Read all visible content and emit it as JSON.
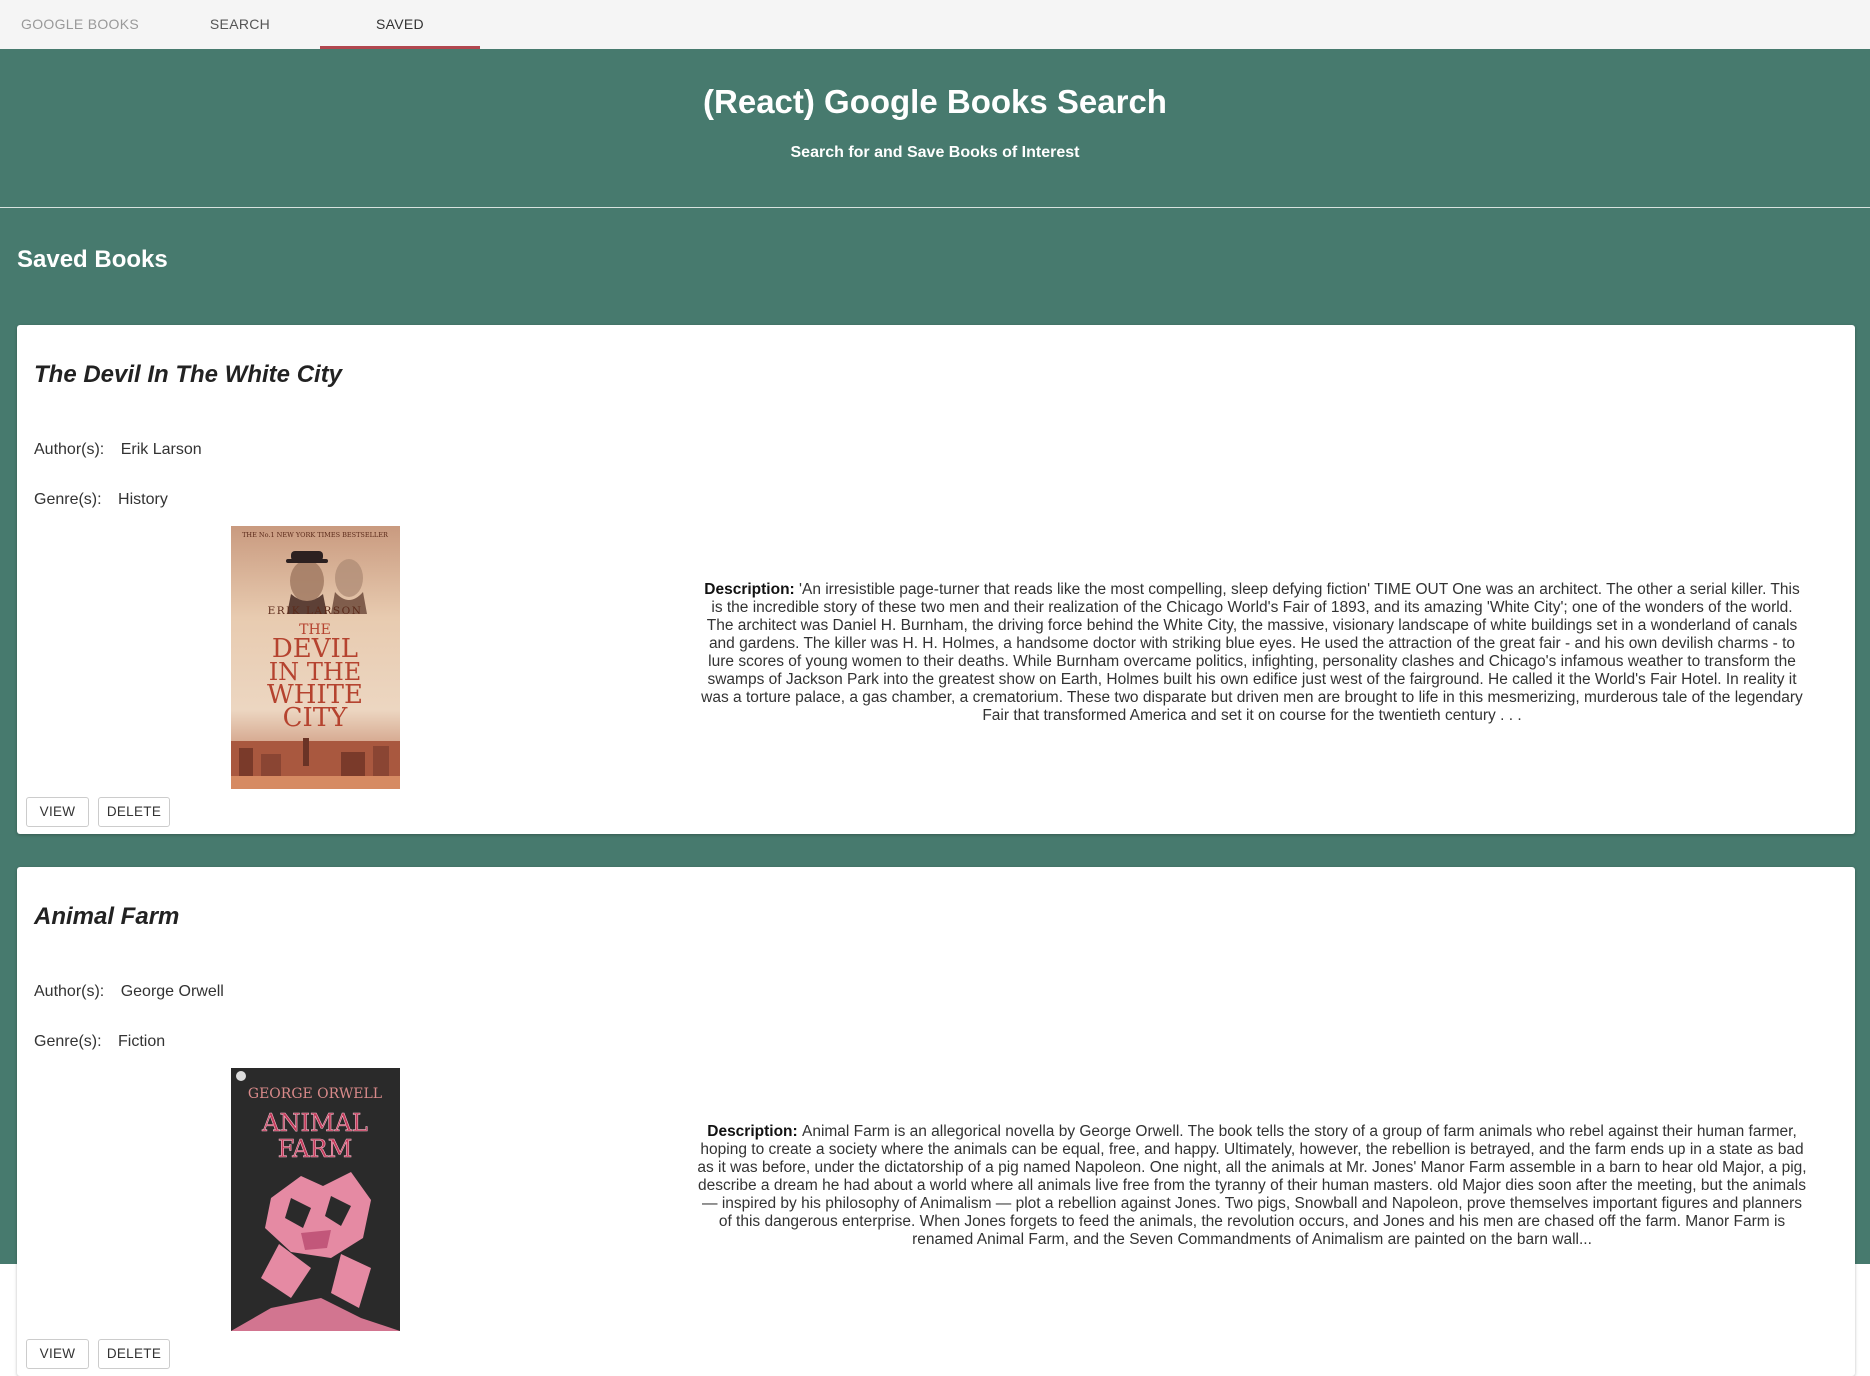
{
  "nav": {
    "brand": "GOOGLE BOOKS",
    "tabs": [
      {
        "label": "SEARCH",
        "active": false
      },
      {
        "label": "SAVED",
        "active": true
      }
    ],
    "active_indicator_color": "#b1474f"
  },
  "hero": {
    "title": "(React) Google Books Search",
    "subtitle": "Search for and Save Books of Interest",
    "background_color": "#477a6e"
  },
  "saved": {
    "heading": "Saved Books",
    "books": [
      {
        "title": "The Devil In The White City",
        "author_label": "Author(s):",
        "author": "Erik Larson",
        "genre_label": "Genre(s):",
        "genre": "History",
        "cover": {
          "banner": "THE No.1 NEW YORK TIMES BESTSELLER",
          "author": "ERIK LARSON",
          "title_lines": [
            "THE",
            "DEVIL",
            "IN THE",
            "WHITE",
            "CITY"
          ]
        },
        "description_label": "Description:",
        "description": "'An irresistible page-turner that reads like the most compelling, sleep defying fiction' TIME OUT One was an architect. The other a serial killer. This is the incredible story of these two men and their realization of the Chicago World's Fair of 1893, and its amazing 'White City'; one of the wonders of the world. The architect was Daniel H. Burnham, the driving force behind the White City, the massive, visionary landscape of white buildings set in a wonderland of canals and gardens. The killer was H. H. Holmes, a handsome doctor with striking blue eyes. He used the attraction of the great fair - and his own devilish charms - to lure scores of young women to their deaths. While Burnham overcame politics, infighting, personality clashes and Chicago's infamous weather to transform the swamps of Jackson Park into the greatest show on Earth, Holmes built his own edifice just west of the fairground. He called it the World's Fair Hotel. In reality it was a torture palace, a gas chamber, a crematorium. These two disparate but driven men are brought to life in this mesmerizing, murderous tale of the legendary Fair that transformed America and set it on course for the twentieth century . . .",
        "view_label": "VIEW",
        "delete_label": "DELETE"
      },
      {
        "title": "Animal Farm",
        "author_label": "Author(s):",
        "author": "George Orwell",
        "genre_label": "Genre(s):",
        "genre": "Fiction",
        "cover": {
          "author": "GEORGE ORWELL",
          "title_lines": [
            "ANIMAL",
            "FARM"
          ]
        },
        "description_label": "Description:",
        "description": "Animal Farm is an allegorical novella by George Orwell. The book tells the story of a group of farm animals who rebel against their human farmer, hoping to create a society where the animals can be equal, free, and happy. Ultimately, however, the rebellion is betrayed, and the farm ends up in a state as bad as it was before, under the dictatorship of a pig named Napoleon. One night, all the animals at Mr. Jones' Manor Farm assemble in a barn to hear old Major, a pig, describe a dream he had about a world where all animals live free from the tyranny of their human masters. old Major dies soon after the meeting, but the animals — inspired by his philosophy of Animalism — plot a rebellion against Jones. Two pigs, Snowball and Napoleon, prove themselves important figures and planners of this dangerous enterprise. When Jones forgets to feed the animals, the revolution occurs, and Jones and his men are chased off the farm. Manor Farm is renamed Animal Farm, and the Seven Commandments of Animalism are painted on the barn wall...",
        "view_label": "VIEW",
        "delete_label": "DELETE"
      }
    ]
  }
}
